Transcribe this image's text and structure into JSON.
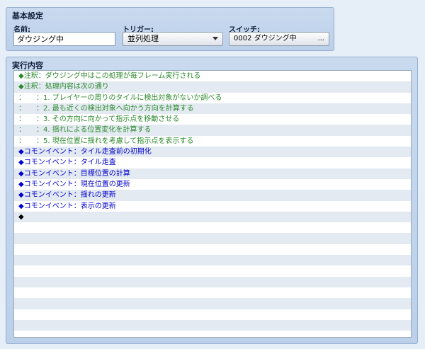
{
  "settings": {
    "title": "基本設定",
    "name_label": "名前:",
    "name_value": "ダウジング中",
    "trigger_label": "トリガー:",
    "trigger_value": "並列処理",
    "switch_label": "スイッチ:",
    "switch_value": "0002 ダウジング中",
    "switch_button": "..."
  },
  "contents": {
    "title": "実行内容",
    "rows": [
      {
        "text": "◆注釈：ダウジング中はこの処理が毎フレーム実行される",
        "color": "green"
      },
      {
        "text": "◆注釈：処理内容は次の通り",
        "color": "green"
      },
      {
        "text": "：　　：1. プレイヤーの周りのタイルに検出対象がないか調べる",
        "color": "green"
      },
      {
        "text": "：　　：2. 最も近くの検出対象へ向かう方向を計算する",
        "color": "green"
      },
      {
        "text": "：　　：3. その方向に向かって指示点を移動させる",
        "color": "green"
      },
      {
        "text": "：　　：4. 揺れによる位置変化を計算する",
        "color": "green"
      },
      {
        "text": "：　　：5. 現在位置に揺れを考慮して指示点を表示する",
        "color": "green"
      },
      {
        "text": "◆コモンイベント：タイル走査前の初期化",
        "color": "blue"
      },
      {
        "text": "◆コモンイベント：タイル走査",
        "color": "blue"
      },
      {
        "text": "◆コモンイベント：目標位置の計算",
        "color": "blue"
      },
      {
        "text": "◆コモンイベント：現在位置の更新",
        "color": "blue"
      },
      {
        "text": "◆コモンイベント：揺れの更新",
        "color": "blue"
      },
      {
        "text": "◆コモンイベント：表示の更新",
        "color": "blue"
      },
      {
        "text": "◆",
        "color": "black"
      }
    ],
    "empty_rows": 10
  },
  "colors": {
    "comment": "#2c8a2c",
    "command": "#0000d0",
    "panel": "#c9daef"
  }
}
